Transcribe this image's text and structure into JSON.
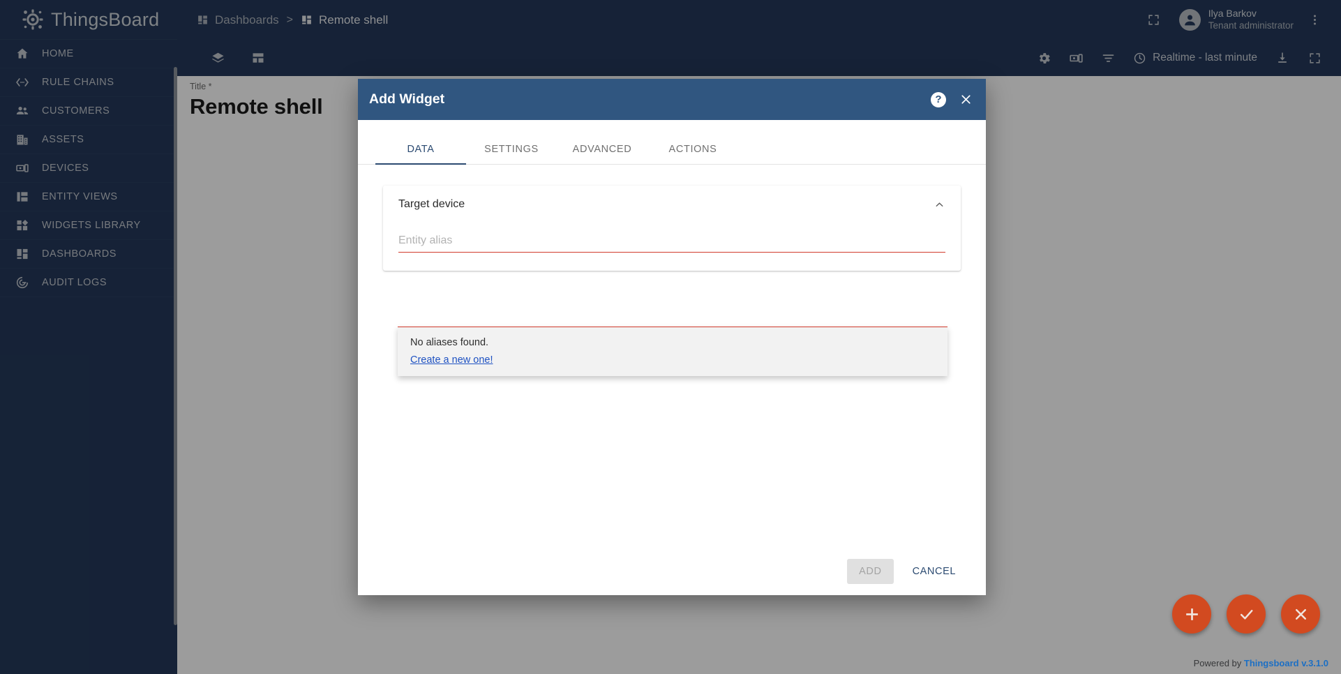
{
  "sidebar": {
    "brand": "ThingsBoard",
    "items": [
      {
        "label": "HOME",
        "icon": "home-icon"
      },
      {
        "label": "RULE CHAINS",
        "icon": "rule-chains-icon"
      },
      {
        "label": "CUSTOMERS",
        "icon": "customers-icon"
      },
      {
        "label": "ASSETS",
        "icon": "assets-icon"
      },
      {
        "label": "DEVICES",
        "icon": "devices-icon"
      },
      {
        "label": "ENTITY VIEWS",
        "icon": "entity-views-icon"
      },
      {
        "label": "WIDGETS LIBRARY",
        "icon": "widgets-library-icon"
      },
      {
        "label": "DASHBOARDS",
        "icon": "dashboards-icon"
      },
      {
        "label": "AUDIT LOGS",
        "icon": "audit-logs-icon"
      }
    ]
  },
  "topbar": {
    "breadcrumb": {
      "parent": "Dashboards",
      "separator": ">",
      "current": "Remote shell"
    },
    "fullscreen_icon": "fullscreen-icon",
    "user": {
      "name": "Ilya Barkov",
      "role": "Tenant administrator"
    },
    "more_icon": "more-vertical-icon"
  },
  "dashboard_toolbar": {
    "layers_icon": "layers-icon",
    "layout_icon": "dashboard-layout-icon",
    "settings_icon": "gear-icon",
    "states_icon": "device-states-icon",
    "filters_icon": "filter-icon",
    "time_label": "Realtime - last minute",
    "time_icon": "clock-icon",
    "export_icon": "download-icon",
    "expand_icon": "fullscreen-icon"
  },
  "dashboard": {
    "title_label": "Title *",
    "title_value": "Remote shell"
  },
  "fabs": [
    {
      "name": "add-widget-fab",
      "glyph": "+"
    },
    {
      "name": "apply-changes-fab",
      "glyph": "check"
    },
    {
      "name": "cancel-changes-fab",
      "glyph": "close"
    }
  ],
  "footer": {
    "powered_prefix": "Powered by ",
    "powered_link": "Thingsboard v.3.1.0"
  },
  "dialog": {
    "title": "Add Widget",
    "help_icon": "help-icon",
    "close_icon": "close-icon",
    "tabs": [
      {
        "label": "DATA",
        "active": true
      },
      {
        "label": "SETTINGS",
        "active": false
      },
      {
        "label": "ADVANCED",
        "active": false
      },
      {
        "label": "ACTIONS",
        "active": false
      }
    ],
    "panel": {
      "title": "Target device",
      "collapse_icon": "chevron-up-icon",
      "alias_placeholder": "Entity alias",
      "alias_value": ""
    },
    "dropdown": {
      "message": "No aliases found.",
      "link": "Create a new one!"
    },
    "buttons": {
      "add": "ADD",
      "cancel": "CANCEL"
    }
  },
  "colors": {
    "sidebar_bg": "#24395a",
    "dialog_header": "#305680",
    "accent_blue": "#2b4a71",
    "fab_orange": "#d24a20",
    "error_red": "#d23b2c",
    "link_blue": "#1f52c2"
  }
}
